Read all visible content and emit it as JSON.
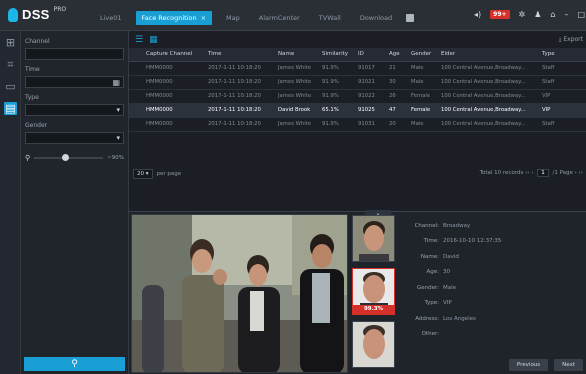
{
  "app": {
    "logo": "DSS",
    "logo_sup": "PRO"
  },
  "tabs": [
    {
      "label": "Live01",
      "active": false
    },
    {
      "label": "Face Recognition",
      "active": true
    },
    {
      "label": "Map",
      "active": false
    },
    {
      "label": "AlarmCenter",
      "active": false
    },
    {
      "label": "TVWall",
      "active": false
    },
    {
      "label": "Download",
      "active": false
    }
  ],
  "topbar": {
    "alarm_count": "99+"
  },
  "filter": {
    "channel_label": "Channel",
    "time_label": "Time",
    "type_label": "Type",
    "gender_label": "Gender",
    "similarity_pct": "~90%",
    "similarity_level": 0.4
  },
  "toolbar": {
    "export_label": "Export"
  },
  "table": {
    "headers": [
      "",
      "Capture Channel",
      "Time",
      "Name",
      "Similarity",
      "ID",
      "Age",
      "Gender",
      "Elder",
      "Type"
    ],
    "rows": [
      {
        "sel": false,
        "cells": [
          "",
          "HMM0000",
          "2017-1-11 10:18:20",
          "James White",
          "91.9%",
          "91017",
          "21",
          "Male",
          "100 Central Avenue,Broadway...",
          "Staff"
        ]
      },
      {
        "sel": false,
        "cells": [
          "",
          "HMM0000",
          "2017-1-11 10:18:20",
          "James White",
          "91.9%",
          "91021",
          "30",
          "Male",
          "100 Central Avenue,Broadway...",
          "Staff"
        ]
      },
      {
        "sel": false,
        "cells": [
          "",
          "HMM0000",
          "2017-1-11 10:18:20",
          "James White",
          "91.9%",
          "91022",
          "26",
          "Female",
          "100 Central Avenue,Broadway...",
          "VIP"
        ]
      },
      {
        "sel": true,
        "cells": [
          "",
          "HMM0000",
          "2017-1-11 10:18:20",
          "David Brook",
          "65.1%",
          "91025",
          "47",
          "Female",
          "100 Central Avenue,Broadway...",
          "VIP"
        ]
      },
      {
        "sel": false,
        "cells": [
          "",
          "HMM0000",
          "2017-1-11 10:18:20",
          "James White",
          "91.9%",
          "91031",
          "20",
          "Male",
          "100 Central Avenue,Broadway...",
          "Staff"
        ]
      }
    ]
  },
  "pager": {
    "per_page": "20",
    "per_page_label": "per page",
    "total": "Total 10 records",
    "page": "1",
    "pages": "/1 Page"
  },
  "detail": {
    "similarity": "99.3%",
    "fields": [
      {
        "k": "Channel:",
        "v": "Broadway"
      },
      {
        "k": "Time:",
        "v": "2016-10-10 12:37:35"
      },
      {
        "k": "Name:",
        "v": "David"
      },
      {
        "k": "Age:",
        "v": "30"
      },
      {
        "k": "Gender:",
        "v": "Male"
      },
      {
        "k": "Type:",
        "v": "VIP"
      },
      {
        "k": "Address:",
        "v": "Los Angeles"
      },
      {
        "k": "Other:",
        "v": ""
      }
    ],
    "previous_label": "Previous",
    "next_label": "Next"
  }
}
